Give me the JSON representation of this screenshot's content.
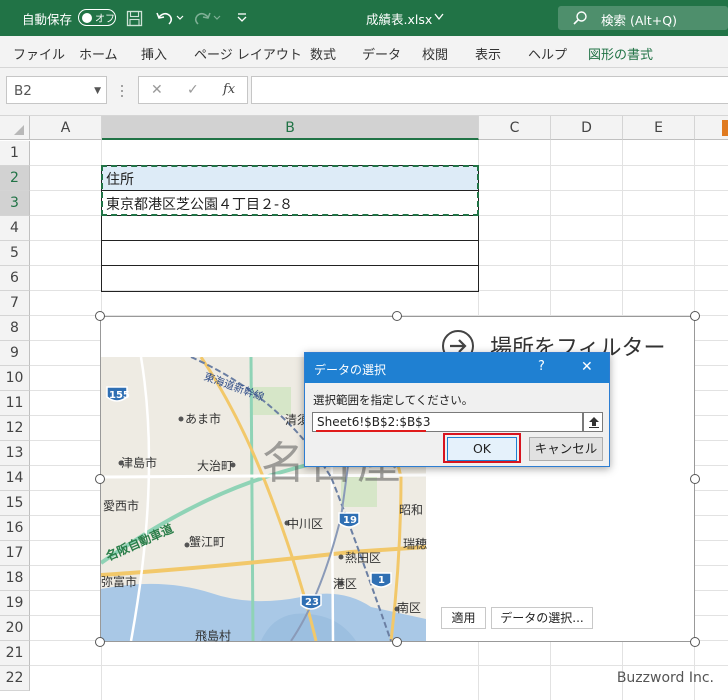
{
  "titlebar": {
    "autosave_label": "自動保存",
    "autosave_state": "オフ",
    "filename": "成績表.xlsx",
    "search_placeholder": "検索 (Alt+Q)",
    "bg_color": "#217346"
  },
  "ribbon": {
    "tabs": [
      "ファイル",
      "ホーム",
      "挿入",
      "ページ レイアウト",
      "数式",
      "データ",
      "校閲",
      "表示",
      "ヘルプ",
      "図形の書式"
    ]
  },
  "formula_bar": {
    "name_box": "B2",
    "cancel_glyph": "✕",
    "enter_glyph": "✓",
    "fx_label": "fx",
    "formula": ""
  },
  "sheet": {
    "columns": [
      "A",
      "B",
      "C",
      "D",
      "E"
    ],
    "rows": [
      "1",
      "2",
      "3",
      "4",
      "5",
      "6",
      "7",
      "8",
      "9",
      "10",
      "11",
      "12",
      "13",
      "14",
      "15",
      "16",
      "17",
      "18",
      "19",
      "20",
      "21",
      "22"
    ],
    "cells": {
      "B2": "住所",
      "B3": "東京都港区芝公園４丁目２-８"
    }
  },
  "map": {
    "filter_label": "場所をフィルター",
    "labels": {
      "ama": "あま市",
      "tsushima": "津島市",
      "oharu": "大治町",
      "aisai": "愛西市",
      "kanie": "蟹江町",
      "nakagawa": "中川区",
      "atsuta": "熱田区",
      "minato": "港区",
      "minami": "南区",
      "tobishima": "飛島村",
      "kiyosu": "清須",
      "showa": "昭和",
      "mizuho": "瑞穂",
      "yatomi": "弥富市",
      "tokai_shinkansen": "東海道新幹線",
      "meihan": "名阪自動車道",
      "nagoya": "名古屋",
      "route_155": "155",
      "route_19": "19",
      "route_23": "23",
      "route_1": "1"
    },
    "apply_button": "適用",
    "select_data_button": "データの選択..."
  },
  "dialog": {
    "title": "データの選択",
    "help": "?",
    "close": "✕",
    "prompt": "選択範囲を指定してください。",
    "range_value": "Sheet6!$B$2:$B$3",
    "ok_button": "OK",
    "cancel_button": "キャンセル",
    "accent": "#1f80d2"
  },
  "watermark": "Buzzword Inc."
}
